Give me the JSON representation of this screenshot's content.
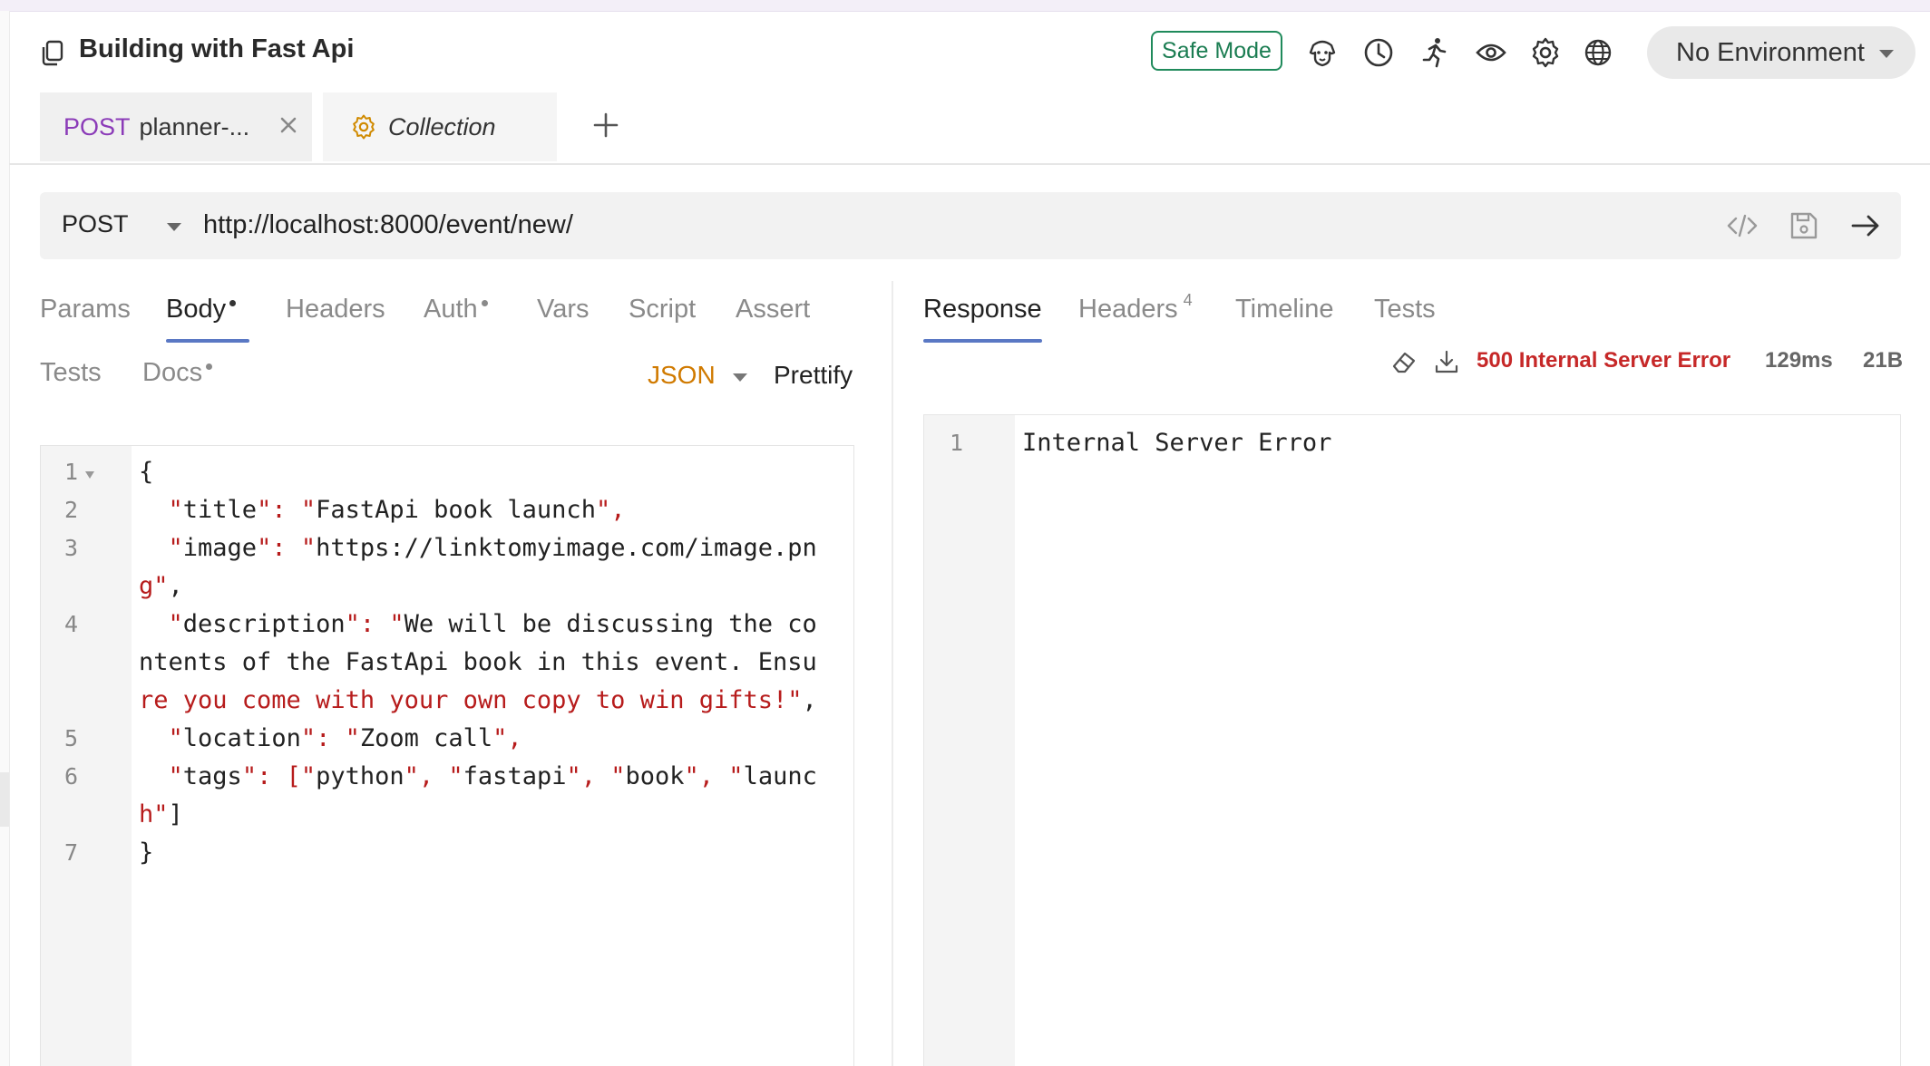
{
  "header": {
    "collection_title": "Building with Fast Api",
    "safe_mode_label": "Safe Mode",
    "icons": [
      "bruno-dog-icon",
      "history-clock-icon",
      "runner-icon",
      "eye-icon",
      "settings-gear-icon",
      "globe-icon"
    ],
    "environment_label": "No Environment"
  },
  "tabs": {
    "request_tab": {
      "method": "POST",
      "name": "planner-..."
    },
    "collection_tab": {
      "name": "Collection"
    }
  },
  "request": {
    "method": "POST",
    "url": "http://localhost:8000/event/new/"
  },
  "request_panel": {
    "tabs": [
      "Params",
      "Body",
      "Headers",
      "Auth",
      "Vars",
      "Script",
      "Assert",
      "Tests",
      "Docs"
    ],
    "active_tab": "Body",
    "body_mode": "JSON",
    "prettify_label": "Prettify",
    "line_numbers": [
      "1",
      "2",
      "3",
      "4",
      "5",
      "6",
      "7"
    ],
    "code_lines": [
      "{",
      "  \"title\": \"FastApi book launch\",",
      "  \"image\": \"https://linktomyimage.com/image.pn",
      "g\",",
      "  \"description\": \"We will be discussing the co",
      "ntents of the FastApi book in this event. Ensu",
      "re you come with your own copy to win gifts!\",",
      "  \"location\": \"Zoom call\",",
      "  \"tags\": [\"python\", \"fastapi\", \"book\", \"launc",
      "h\"]",
      "}"
    ]
  },
  "response_panel": {
    "tabs": [
      "Response",
      "Headers",
      "Timeline",
      "Tests"
    ],
    "headers_count": "4",
    "active_tab": "Response",
    "status": "500 Internal Server Error",
    "time": "129ms",
    "size": "21B",
    "line_numbers": [
      "1"
    ],
    "body": "Internal Server Error"
  },
  "colors": {
    "post_method": "#8b3bb8",
    "safe_mode": "#1b7d52",
    "error_status": "#c62828",
    "json_mode": "#d07a00",
    "active_underline": "#5a78c4"
  }
}
